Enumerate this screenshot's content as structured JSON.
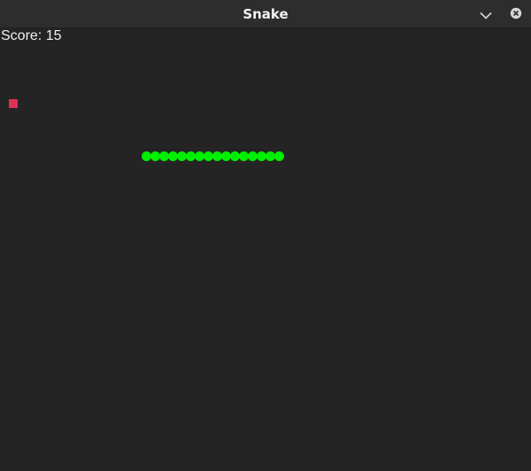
{
  "window": {
    "title": "Snake",
    "menu_icon": "chevron-down-icon",
    "close_icon": "close-icon"
  },
  "game": {
    "score_text": "Score: 15",
    "score_value": 15,
    "snake_length": 16,
    "direction": "horizontal",
    "colors": {
      "background": "#242424",
      "snake": "#00ee00",
      "food": "#dc3254",
      "text": "#f0f0f0"
    }
  }
}
